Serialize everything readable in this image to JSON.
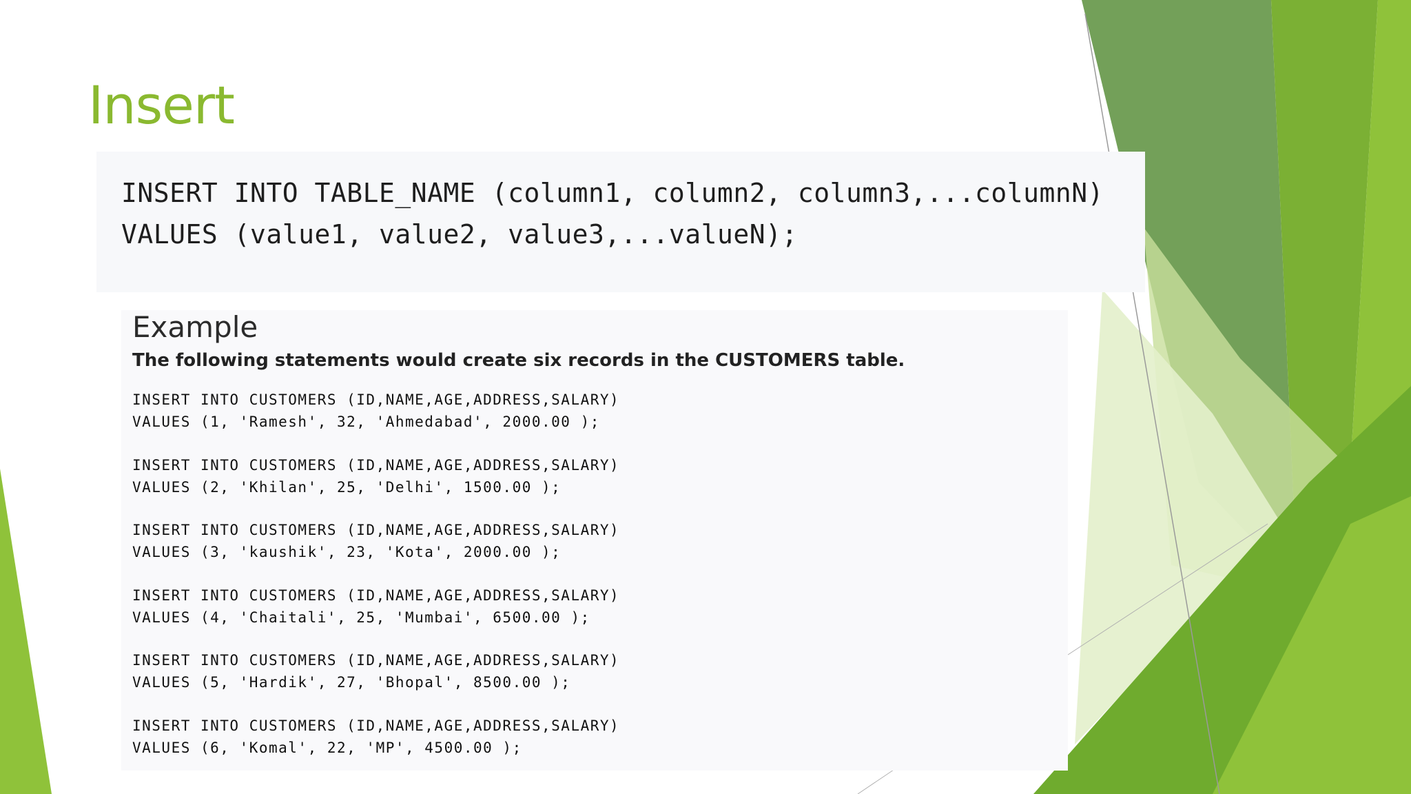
{
  "slide": {
    "title": "Insert",
    "accent_color": "#8ab930"
  },
  "syntax": {
    "line1": "INSERT INTO TABLE_NAME (column1, column2, column3,...columnN)",
    "line2": "VALUES (value1, value2, value3,...valueN);"
  },
  "example": {
    "heading": "Example",
    "description": "The following statements would create six records in the CUSTOMERS table.",
    "statements": [
      {
        "insert": "INSERT INTO CUSTOMERS (ID,NAME,AGE,ADDRESS,SALARY)",
        "values": "VALUES (1, 'Ramesh', 32, 'Ahmedabad', 2000.00 );"
      },
      {
        "insert": "INSERT INTO CUSTOMERS (ID,NAME,AGE,ADDRESS,SALARY)",
        "values": "VALUES (2, 'Khilan', 25, 'Delhi', 1500.00 );"
      },
      {
        "insert": "INSERT INTO CUSTOMERS (ID,NAME,AGE,ADDRESS,SALARY)",
        "values": "VALUES (3, 'kaushik', 23, 'Kota', 2000.00 );"
      },
      {
        "insert": "INSERT INTO CUSTOMERS (ID,NAME,AGE,ADDRESS,SALARY)",
        "values": "VALUES (4, 'Chaitali', 25, 'Mumbai', 6500.00 );"
      },
      {
        "insert": "INSERT INTO CUSTOMERS (ID,NAME,AGE,ADDRESS,SALARY)",
        "values": "VALUES (5, 'Hardik', 27, 'Bhopal', 8500.00 );"
      },
      {
        "insert": "INSERT INTO CUSTOMERS (ID,NAME,AGE,ADDRESS,SALARY)",
        "values": "VALUES (6, 'Komal', 22, 'MP', 4500.00 );"
      }
    ]
  }
}
